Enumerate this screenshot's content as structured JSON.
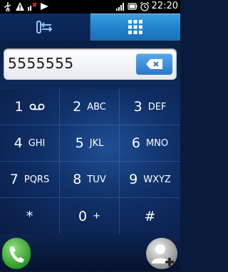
{
  "status_bar": {
    "clock": "22:20",
    "left_icons": [
      "usb-icon",
      "warning-icon",
      "no-signal-icon",
      "play-store-icon"
    ],
    "right_icons": [
      "signal-icon",
      "battery-icon",
      "alarm-icon"
    ]
  },
  "tabs": [
    {
      "name": "call-log",
      "icon": "call-log-icon",
      "active": false
    },
    {
      "name": "dialpad",
      "icon": "dialpad-grid-icon",
      "active": true
    }
  ],
  "dialer": {
    "number": "5555555",
    "backspace_icon": "backspace-icon"
  },
  "keypad": [
    {
      "digit": "1",
      "letters": "",
      "icon": "voicemail-icon"
    },
    {
      "digit": "2",
      "letters": "ABC"
    },
    {
      "digit": "3",
      "letters": "DEF"
    },
    {
      "digit": "4",
      "letters": "GHI"
    },
    {
      "digit": "5",
      "letters": "JKL"
    },
    {
      "digit": "6",
      "letters": "MNO"
    },
    {
      "digit": "7",
      "letters": "PQRS"
    },
    {
      "digit": "8",
      "letters": "TUV"
    },
    {
      "digit": "9",
      "letters": "WXYZ"
    },
    {
      "digit": "*",
      "letters": ""
    },
    {
      "digit": "0",
      "letters": "+"
    },
    {
      "digit": "#",
      "letters": ""
    }
  ],
  "bottom": {
    "call_icon": "phone-call-icon",
    "add_contact_icon": "add-contact-icon"
  },
  "colors": {
    "accent_blue": "#2a8fd6",
    "call_green": "#2f9a2a"
  }
}
